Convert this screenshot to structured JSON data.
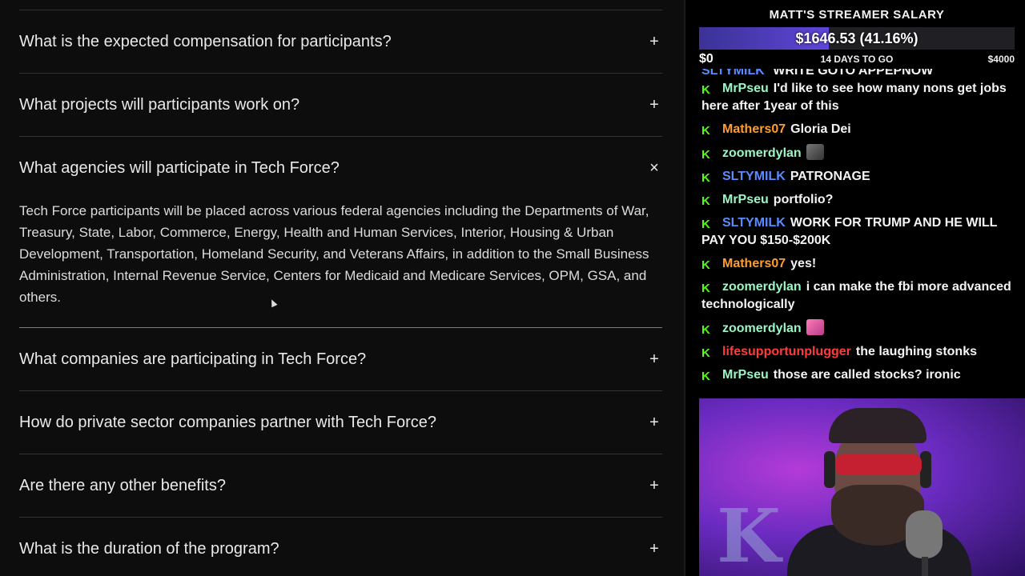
{
  "faq": {
    "items": [
      {
        "question": "What is the expected compensation for participants?",
        "toggle": "+"
      },
      {
        "question": "What projects will participants work on?",
        "toggle": "+"
      },
      {
        "question": "What agencies will participate in Tech Force?",
        "toggle": "×",
        "answer": "Tech Force participants will be placed across various federal agencies including the Departments of War, Treasury, State, Labor, Commerce, Energy, Health and Human Services, Interior, Housing & Urban Development, Transportation, Homeland Security, and Veterans Affairs, in addition to the Small Business Administration, Internal Revenue Service, Centers for Medicaid and Medicare Services, OPM, GSA, and others."
      },
      {
        "question": "What companies are participating in Tech Force?",
        "toggle": "+"
      },
      {
        "question": "How do private sector companies partner with Tech Force?",
        "toggle": "+"
      },
      {
        "question": "Are there any other benefits?",
        "toggle": "+"
      },
      {
        "question": "What is the duration of the program?",
        "toggle": "+"
      }
    ]
  },
  "salary": {
    "title": "MATT'S STREAMER SALARY",
    "amount_text": "$1646.53 (41.16%)",
    "progress_fraction": 0.4116,
    "min_label": "$0",
    "days_label": "14 DAYS TO GO",
    "max_label": "$4000",
    "fill_color": "#5e46d8"
  },
  "chat": {
    "cut_message": {
      "user": "SLTYMILK",
      "text": "WRITE GOTO APPEPNOW"
    },
    "messages": [
      {
        "user": "MrPseu",
        "color": "teal",
        "text": "I'd like to see how many nons get jobs here after 1year of this"
      },
      {
        "user": "Mathers07",
        "color": "orange",
        "text": "Gloria Dei"
      },
      {
        "user": "zoomerdylan",
        "color": "teal",
        "text": "",
        "emote": "gray"
      },
      {
        "user": "SLTYMILK",
        "color": "blue",
        "text": "PATRONAGE"
      },
      {
        "user": "MrPseu",
        "color": "teal",
        "text": "portfolio?"
      },
      {
        "user": "SLTYMILK",
        "color": "blue",
        "text": "WORK FOR TRUMP AND HE WILL PAY YOU $150-$200K"
      },
      {
        "user": "Mathers07",
        "color": "orange",
        "text": "yes!"
      },
      {
        "user": "zoomerdylan",
        "color": "teal",
        "text": "i can make the fbi more advanced technologically"
      },
      {
        "user": "zoomerdylan",
        "color": "teal",
        "text": "",
        "emote": "pink"
      },
      {
        "user": "lifesupportunplugger",
        "color": "red",
        "text": "the laughing stonks"
      },
      {
        "user": "MrPseu",
        "color": "teal",
        "text": "those are called stocks? ironic"
      }
    ],
    "badge_icon": "kick-badge-icon",
    "badge_glyph": "K"
  },
  "webcam": {
    "backdrop_letter": "K"
  }
}
